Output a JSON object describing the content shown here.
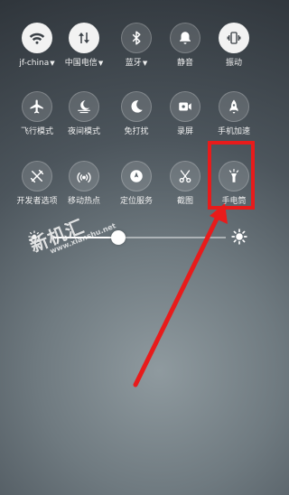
{
  "quick_settings": {
    "tiles": {
      "wifi": {
        "label": "jf-china",
        "dropdown": "▼",
        "icon": "wifi-icon",
        "state": "on"
      },
      "carrier": {
        "label": "中国电信",
        "dropdown": "▼",
        "icon": "mobile-data-icon",
        "state": "on"
      },
      "bluetooth": {
        "label": "蓝牙",
        "dropdown": "▼",
        "icon": "bluetooth-icon",
        "state": "off"
      },
      "silent": {
        "label": "静音",
        "icon": "bell-icon",
        "state": "off"
      },
      "vibrate": {
        "label": "振动",
        "icon": "vibrate-icon",
        "state": "on"
      },
      "airplane": {
        "label": "飞行模式",
        "icon": "airplane-icon",
        "state": "off"
      },
      "night": {
        "label": "夜间模式",
        "icon": "night-mode-icon",
        "state": "off"
      },
      "dnd": {
        "label": "免打扰",
        "icon": "moon-icon",
        "state": "off"
      },
      "record": {
        "label": "录屏",
        "icon": "screen-record-icon",
        "state": "off"
      },
      "boost": {
        "label": "手机加速",
        "icon": "rocket-icon",
        "state": "off"
      },
      "developer": {
        "label": "开发者选项",
        "icon": "tools-icon",
        "state": "off"
      },
      "hotspot": {
        "label": "移动热点",
        "icon": "hotspot-icon",
        "state": "off"
      },
      "location": {
        "label": "定位服务",
        "icon": "location-icon",
        "state": "off"
      },
      "screenshot": {
        "label": "截图",
        "icon": "scissors-icon",
        "state": "off"
      },
      "torch": {
        "label": "手电筒",
        "icon": "flashlight-icon",
        "state": "off"
      }
    },
    "brightness": {
      "level": 0.375,
      "low_icon": "brightness-low-icon",
      "high_icon": "brightness-high-icon"
    }
  },
  "watermark": {
    "main": "新机汇",
    "sub": "www.xianshu.net"
  },
  "annotation": {
    "color": "#e81b1b",
    "target": "torch"
  }
}
